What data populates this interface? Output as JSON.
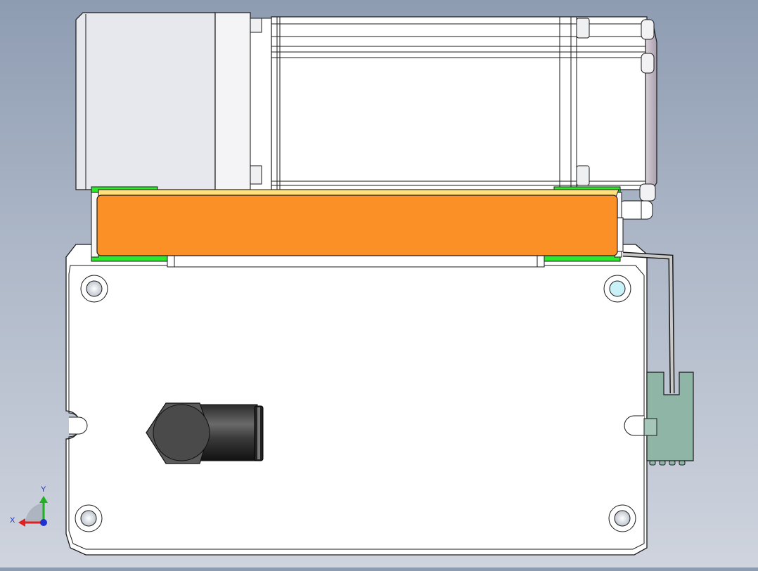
{
  "viewport": {
    "background_top": "#8e9cb2",
    "background_bottom": "#cfd4de"
  },
  "model": {
    "motor_body_color": "#ffffff",
    "motor_flange_color": "#e6e8ee",
    "motor_endcap_color": "#c4b9c6",
    "belt_cover_color": "#fb9126",
    "belt_cover_top_color": "#ffe079",
    "mount_pad_color": "#2ee82e",
    "base_plate_color": "#ffffff",
    "connector_color": "#8eb5a6",
    "fitting_color": "#3a3a3a",
    "outline_color": "#1a1a1a"
  },
  "triad": {
    "x_label": "X",
    "y_label": "Y",
    "x_color": "#e02020",
    "y_color": "#20b020",
    "z_color": "#2030d0"
  }
}
